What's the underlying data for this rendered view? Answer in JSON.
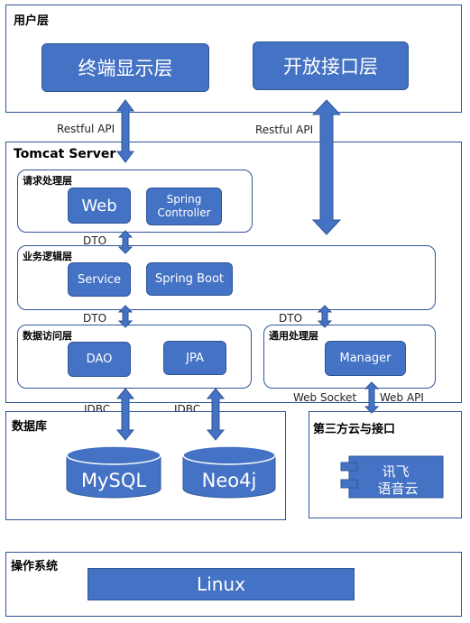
{
  "user_layer": {
    "title": "用户层",
    "terminal": "终端显示层",
    "open_api": "开放接口层"
  },
  "conn_labels": {
    "restful_left": "Restful API",
    "restful_right": "Restful API"
  },
  "tomcat": {
    "title": "Tomcat Server",
    "request_layer": {
      "title": "请求处理层",
      "web": "Web",
      "spring_controller": "Spring\nController"
    },
    "dto_1": "DTO",
    "logic_layer": {
      "title": "业务逻辑层",
      "service": "Service",
      "spring_boot": "Spring Boot"
    },
    "dto_2": "DTO",
    "dto_3": "DTO",
    "data_access": {
      "title": "数据访问层",
      "dao": "DAO",
      "jpa": "JPA"
    },
    "common_layer": {
      "title": "通用处理层",
      "manager": "Manager"
    }
  },
  "db_labels": {
    "jdbc_1": "JDBC",
    "jdbc_2": "JDBC",
    "web_socket": "Web Socket",
    "web_api": "Web API"
  },
  "database": {
    "title": "数据库",
    "mysql": "MySQL",
    "neo4j": "Neo4j"
  },
  "third_party": {
    "title": "第三方云与接口",
    "xunfei": "讯飞\n语音云"
  },
  "os": {
    "title": "操作系统",
    "linux": "Linux"
  },
  "colors": {
    "fill": "#4472c4",
    "border": "#2f5597"
  }
}
